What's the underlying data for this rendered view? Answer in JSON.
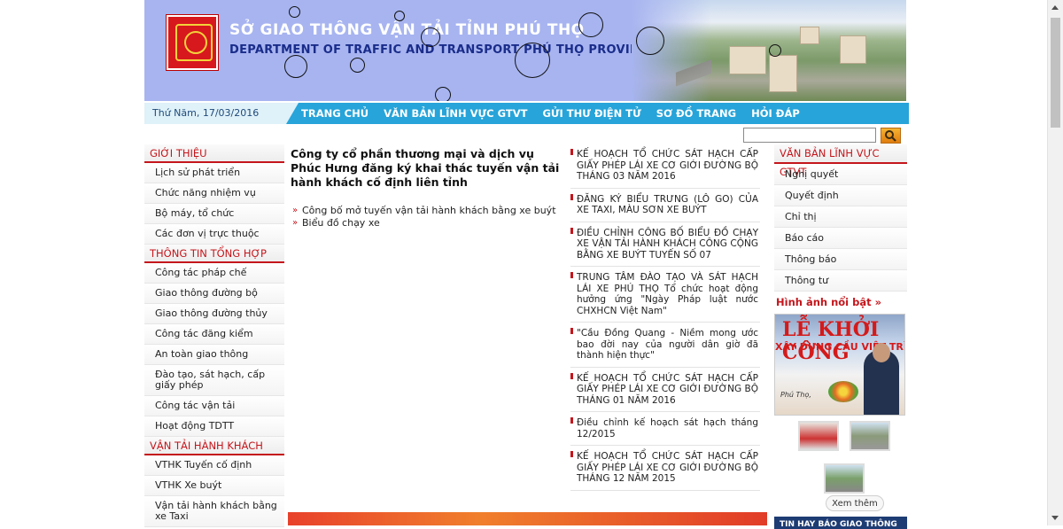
{
  "header": {
    "title_vn": "SỞ GIAO THÔNG VẬN TẢI TỈNH PHÚ THỌ",
    "title_en": "DEPARTMENT OF TRAFFIC AND TRANSPORT PHÚ THỌ PROVINCE",
    "logo_icon": "provincial-emblem-icon"
  },
  "nav": {
    "date": "Thứ Năm, 17/03/2016",
    "items": [
      "TRANG CHỦ",
      "VĂN BẢN LĨNH VỰC GTVT",
      "GỬI THƯ ĐIỆN TỬ",
      "SƠ ĐỒ TRANG",
      "HỎI ĐÁP"
    ]
  },
  "search": {
    "value": "",
    "button_icon": "search-icon"
  },
  "left_sidebar": {
    "sections": [
      {
        "title": "GIỚI THIỆU",
        "items": [
          "Lịch sử phát triển",
          "Chức năng nhiệm vụ",
          "Bộ máy, tổ chức",
          "Các đơn vị trực thuộc"
        ]
      },
      {
        "title": "THÔNG TIN TỔNG HỢP",
        "items": [
          "Công tác pháp chế",
          "Giao thông đường bộ",
          "Giao thông đường thủy",
          "Công tác đăng kiểm",
          "An toàn giao thông",
          "Đào tạo, sát hạch, cấp giấy phép",
          "Công tác vận tải",
          "Hoạt động TDTT"
        ]
      },
      {
        "title": "VẬN TẢI HÀNH KHÁCH",
        "items": [
          "VTHK Tuyến cố định",
          "VTHK Xe buýt",
          "Vận tải hành khách bằng xe Taxi"
        ]
      }
    ]
  },
  "main": {
    "headline": "Công ty cổ phần thương mại và dịch vụ Phúc Hưng đăng ký khai thác tuyến vận tải hành khách cố định liên tỉnh",
    "links": [
      "Công bố mở tuyến vận tải hành khách bằng xe buýt",
      "Biểu đồ chạy xe"
    ]
  },
  "news": [
    "KẾ HOẠCH TỔ CHỨC SÁT HẠCH CẤP GIẤY PHÉP LÁI XE CƠ GIỚI ĐƯỜNG BỘ THÁNG 03 NĂM 2016",
    "ĐĂNG KÝ BIỂU TRƯNG (LÔ GO) CỦA XE TAXI, MÀU SƠN XE BUÝT",
    "ĐIỀU CHỈNH CÔNG BỐ BIỂU ĐỒ CHẠY XE VẬN TẢI HÀNH KHÁCH CÔNG CỘNG BẰNG XE BUÝT TUYẾN SỐ 07",
    "TRUNG TÂM ĐÀO TẠO VÀ SÁT HẠCH LÁI XE PHÚ THỌ Tổ chức hoạt động hưởng ứng \"Ngày Pháp luật nước CHXHCN Việt Nam\"",
    "\"Cầu Đồng Quang - Niềm mong ước bao đời nay của người dân giờ đã thành hiện thực\"",
    "KẾ HOẠCH TỔ CHỨC SÁT HẠCH CẤP GIẤY PHÉP LÁI XE CƠ GIỚI ĐƯỜNG BỘ THÁNG 01 NĂM 2016",
    "Điều chỉnh kế hoạch sát hạch tháng 12/2015",
    "KẾ HOẠCH TỔ CHỨC SÁT HẠCH CẤP GIẤY PHÉP LÁI XE CƠ GIỚI ĐƯỜNG BỘ THÁNG 12 NĂM 2015"
  ],
  "right_sidebar": {
    "title": "VĂN BẢN LĨNH VỰC GTVT",
    "items": [
      "Nghị quyết",
      "Quyết định",
      "Chỉ thị",
      "Báo cáo",
      "Thông báo",
      "Thông tư"
    ],
    "highlight_title": "Hình ảnh nổi bật »",
    "highlight_text_1": "LỄ KHỞI CÔNG",
    "highlight_text_2": "XÂY DỰNG CẦU VIỆT TRÌ M",
    "highlight_text_3": "Phú Thọ,",
    "more_label": "Xem thêm",
    "news_bar": "TIN HAY BÁO GIAO THÔNG"
  }
}
